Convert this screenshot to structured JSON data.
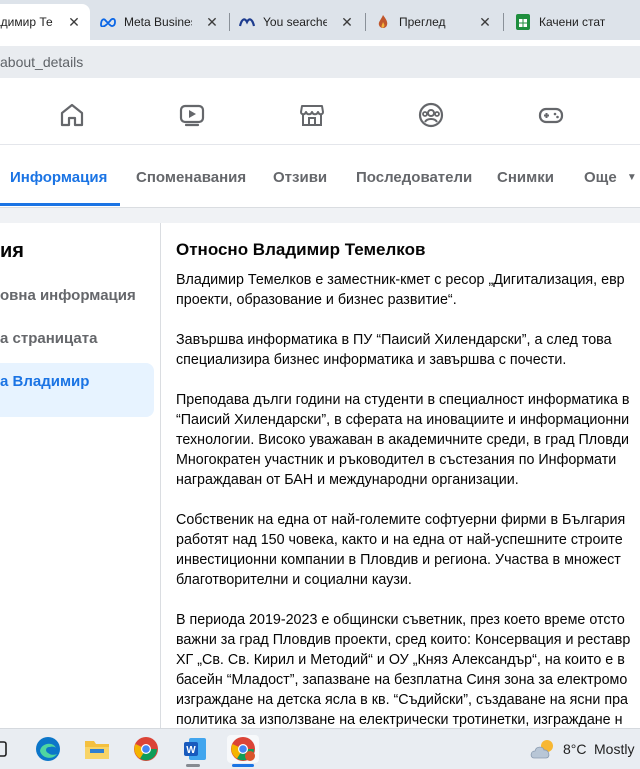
{
  "browser": {
    "tabs": [
      {
        "title": "адимир Те",
        "favicon": "facebook-icon",
        "active": true
      },
      {
        "title": "Meta Busines",
        "favicon": "meta-icon",
        "active": false
      },
      {
        "title": "You searched",
        "favicon": "meta-dark-icon",
        "active": false
      },
      {
        "title": "Преглед",
        "favicon": "flame-icon",
        "active": false
      },
      {
        "title": "Качени стат",
        "favicon": "sheets-icon",
        "active": false
      }
    ],
    "address": "about_details"
  },
  "facebook_nav": {
    "icons": [
      "home-icon",
      "video-icon",
      "marketplace-icon",
      "groups-icon",
      "gaming-icon"
    ]
  },
  "profile_tabs": {
    "items": [
      "Информация",
      "Споменавания",
      "Отзиви",
      "Последователи",
      "Снимки",
      "Още"
    ],
    "active": "Информация"
  },
  "about_sidebar": {
    "title": "ия",
    "items": [
      "овна информация",
      "а страницата",
      "а Владимир"
    ],
    "active_index": 2
  },
  "about_content": {
    "title": "Относно Владимир Темелков",
    "paragraphs": [
      [
        "Владимир Темелков е заместник-кмет с ресор „Дигитализация, евр",
        "проекти, образование и бизнес развитие“."
      ],
      [
        "Завършва информатика в ПУ “Паисий Хилендарски”, а след това",
        "специализира бизнес информатика и завършва с почести."
      ],
      [
        "Преподава дълги години на студенти в специалност информатика в",
        "“Паисий Хилендарски”, в сферата на иновациите и информационни",
        "технологии. Високо уважаван в академичните среди, в град Пловди",
        "Многократен участник и ръководител в състезания по Информати",
        "награждаван от БАН и международни организации."
      ],
      [
        "Собственик на една от най-големите софтуерни фирми в България",
        "работят над 150 човека, както и на една от най-успешните строите",
        "инвестиционни компании в Пловдив и региона. Участва в множест",
        "благотворителни и социални каузи."
      ],
      [
        "В периода 2019-2023 е общински съветник, през което време отсто",
        "важни за град Пловдив проекти, сред които: Консервация и реставр",
        "ХГ „Св. Св. Кирил и Методий“ и ОУ „Княз Александър“, на които е в",
        "басейн “Младост”, запазване на безплатна Синя зона за електромо",
        "изграждане на детска ясла в кв. “Съдийски”,  създаване на ясни пра",
        "политика за използване на електрически тротинетки, изграждане н"
      ]
    ]
  },
  "taskbar": {
    "icons": [
      "task-view-icon",
      "edge-icon",
      "file-explorer-icon",
      "chrome-icon",
      "word-icon",
      "chrome-profile-icon"
    ],
    "weather": {
      "temp": "8°C",
      "text": "Mostly",
      "icon": "partly-cloudy-icon"
    }
  },
  "colors": {
    "accent": "#1b74e4",
    "active_bg": "#e7f3ff",
    "page_bg": "#f0f2f5"
  }
}
